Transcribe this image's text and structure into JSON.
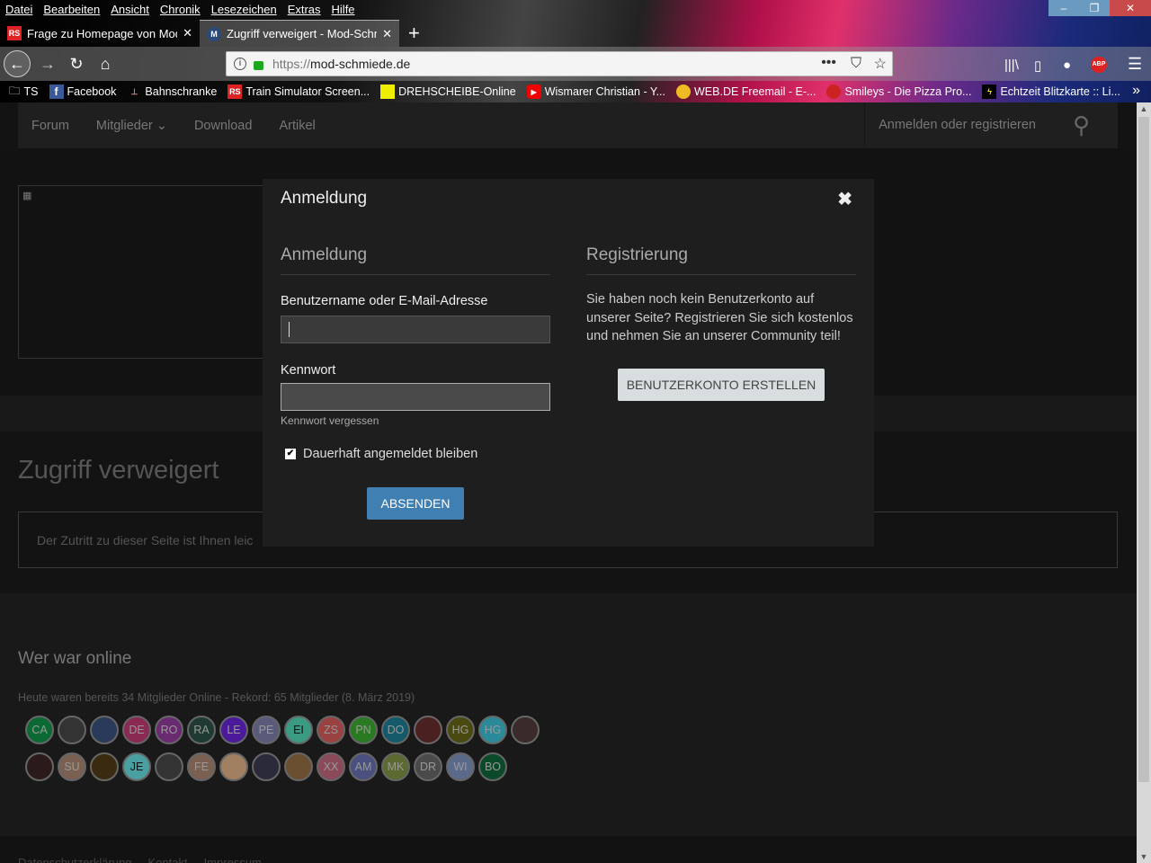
{
  "browser": {
    "menu": [
      "Datei",
      "Bearbeiten",
      "Ansicht",
      "Chronik",
      "Lesezeichen",
      "Extras",
      "Hilfe"
    ],
    "tabs": [
      {
        "label": "Frage zu Homepage von Mod S",
        "favicon": "RS"
      },
      {
        "label": "Zugriff verweigert - Mod-Schmiede",
        "favicon": "M"
      }
    ],
    "url_prefix": "https://",
    "url_host": "mod-schmiede.de",
    "bookmarks": [
      {
        "label": "TS",
        "icon": "folder-icon"
      },
      {
        "label": "Facebook",
        "icon": "f"
      },
      {
        "label": "Bahnschranke",
        "icon": "barrier-icon"
      },
      {
        "label": "Train Simulator Screen...",
        "icon": "RS"
      },
      {
        "label": "DREHSCHEIBE-Online",
        "icon": "ds-icon"
      },
      {
        "label": "Wismarer Christian - Y...",
        "icon": "youtube-icon"
      },
      {
        "label": "WEB.DE Freemail - E-...",
        "icon": "webde-icon"
      },
      {
        "label": "Smileys - Die Pizza Pro...",
        "icon": "smiley-icon"
      },
      {
        "label": "Echtzeit Blitzkarte :: Li...",
        "icon": "lightning-icon"
      }
    ],
    "abp": "ABP"
  },
  "site": {
    "nav": [
      "Forum",
      "Mitglieder ⌄",
      "Download",
      "Artikel"
    ],
    "login_link": "Anmelden oder registrieren",
    "page_title": "Zugriff verweigert",
    "message": "Der Zutritt zu dieser Seite ist Ihnen leic",
    "online_title": "Wer war online",
    "online_stat": "Heute waren bereits 34 Mitglieder Online - Rekord: 65 Mitglieder (8. März 2019)",
    "avatars_row1": [
      {
        "t": "CA",
        "c": "#0b6a34"
      },
      {
        "t": "",
        "c": "#333"
      },
      {
        "t": "",
        "c": "#2a3a5a"
      },
      {
        "t": "DE",
        "c": "#8a2a52"
      },
      {
        "t": "RO",
        "c": "#6a2a72"
      },
      {
        "t": "RA",
        "c": "#1e3a32"
      },
      {
        "t": "LE",
        "c": "#4a1a9a"
      },
      {
        "t": "PE",
        "c": "#5a5a7a"
      },
      {
        "t": "EI",
        "c": "#3a9a82",
        "d": true
      },
      {
        "t": "ZS",
        "c": "#9a4242"
      },
      {
        "t": "PN",
        "c": "#2a7a22"
      },
      {
        "t": "DO",
        "c": "#145a6a"
      },
      {
        "t": "",
        "c": "#4a2020"
      },
      {
        "t": "HG",
        "c": "#4a4a10"
      },
      {
        "t": "HG",
        "c": "#2a8a9a"
      },
      {
        "t": "",
        "c": "#3a2a2a"
      }
    ],
    "avatars_row2": [
      {
        "t": "",
        "c": "#2a1a1a"
      },
      {
        "t": "SU",
        "c": "#7a6050"
      },
      {
        "t": "",
        "c": "#3a2a10"
      },
      {
        "t": "JE",
        "c": "#4aa0a0",
        "d": true
      },
      {
        "t": "",
        "c": "#333"
      },
      {
        "t": "FE",
        "c": "#7a6050"
      },
      {
        "t": "",
        "c": "#a08060"
      },
      {
        "t": "",
        "c": "#2a2a3a"
      },
      {
        "t": "",
        "c": "#6a5030"
      },
      {
        "t": "XX",
        "c": "#8a4a5a"
      },
      {
        "t": "AM",
        "c": "#4a5080"
      },
      {
        "t": "MK",
        "c": "#5a6a30"
      },
      {
        "t": "DR",
        "c": "#4a4a4a"
      },
      {
        "t": "WI",
        "c": "#5a6a8a"
      },
      {
        "t": "BO",
        "c": "#0a4a2a"
      }
    ],
    "footer": [
      "Datenschutzerklärung",
      "Kontakt",
      "Impressum"
    ]
  },
  "modal": {
    "title": "Anmeldung",
    "login_heading": "Anmeldung",
    "username_label": "Benutzername oder E-Mail-Adresse",
    "username_value": "",
    "password_label": "Kennwort",
    "forgot": "Kennwort vergessen",
    "remember": "Dauerhaft angemeldet bleiben",
    "remember_checked": true,
    "submit": "ABSENDEN",
    "register_heading": "Registrierung",
    "register_text": "Sie haben noch kein Benutzerkonto auf unserer Seite? Registrieren Sie sich kostenlos und nehmen Sie an unserer Community teil!",
    "register_button": "BENUTZERKONTO ERSTELLEN"
  }
}
